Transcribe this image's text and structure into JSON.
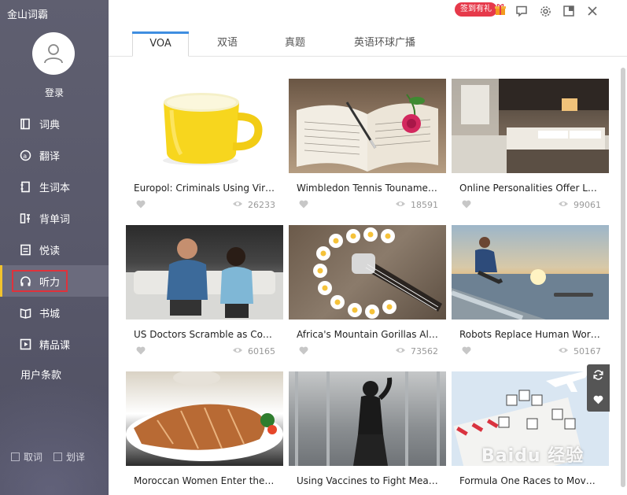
{
  "app": {
    "title": "金山词霸"
  },
  "user": {
    "login_label": "登录"
  },
  "sidebar": {
    "items": [
      {
        "label": "词典",
        "icon": "book-icon"
      },
      {
        "label": "翻译",
        "icon": "translate-icon"
      },
      {
        "label": "生词本",
        "icon": "notebook-icon"
      },
      {
        "label": "背单词",
        "icon": "memorize-icon"
      },
      {
        "label": "悦读",
        "icon": "reading-icon"
      },
      {
        "label": "听力",
        "icon": "headphones-icon",
        "active": true
      },
      {
        "label": "书城",
        "icon": "open-book-icon"
      },
      {
        "label": "精品课",
        "icon": "video-icon"
      }
    ],
    "terms_label": "用户条款",
    "options": [
      {
        "label": "取词",
        "checked": false
      },
      {
        "label": "划译",
        "checked": false
      }
    ]
  },
  "topbar": {
    "gift_label": "签到有礼"
  },
  "tabs": [
    {
      "label": "VOA",
      "active": true
    },
    {
      "label": "双语"
    },
    {
      "label": "真题"
    },
    {
      "label": "英语环球广播"
    }
  ],
  "cards": [
    {
      "title": "Europol: Criminals Using Viru...",
      "views": "26233"
    },
    {
      "title": "Wimbledon Tennis Tounamen...",
      "views": "18591"
    },
    {
      "title": "Online Personalities Offer Lau...",
      "views": "99061"
    },
    {
      "title": "US Doctors Scramble as Coro...",
      "views": "60165"
    },
    {
      "title": "Africa's Mountain Gorillas Als...",
      "views": "73562"
    },
    {
      "title": "Robots Replace Human Work...",
      "views": "50167"
    },
    {
      "title": "Moroccan Women Enter the ...",
      "views": ""
    },
    {
      "title": "Using Vaccines to Fight Meas...",
      "views": ""
    },
    {
      "title": "Formula One Races to Move ...",
      "views": ""
    }
  ],
  "watermark": "Baidu 经验",
  "colors": {
    "sidebar": "#5c5c6e",
    "accent_tab": "#3f8ee0",
    "highlight_box": "#e0323b",
    "gift_badge": "#e6394a"
  }
}
